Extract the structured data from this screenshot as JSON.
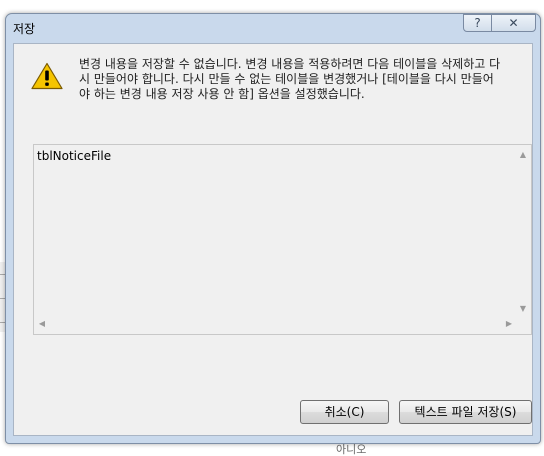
{
  "dialog": {
    "title": "저장",
    "help_label": "?",
    "close_label": "✕",
    "message_lines": [
      "변경 내용을 저장할 수 없습니다. 변경 내용을 적용하려면 다음 테이블을 삭제하고 다",
      "시 만들어야 합니다. 다시 만들 수 없는 테이블을 변경했거나 [테이블을 다시 만들어",
      "야 하는 변경 내용 저장 사용 안 함] 옵션을 설정했습니다."
    ],
    "list_items": [
      "tblNoticeFile"
    ],
    "buttons": {
      "cancel_label": "취소(C)",
      "save_text_label": "텍스트 파일 저장(S)"
    }
  },
  "background": {
    "partial_text": "아니오"
  },
  "colors": {
    "frame": "#c9d9ec",
    "client": "#f0f0f0",
    "warning": "#f5c400"
  },
  "icons": {
    "warning": "warning-icon",
    "scroll": [
      "scroll-up-arrow-icon",
      "scroll-down-arrow-icon",
      "scroll-left-arrow-icon",
      "scroll-right-arrow-icon"
    ]
  }
}
